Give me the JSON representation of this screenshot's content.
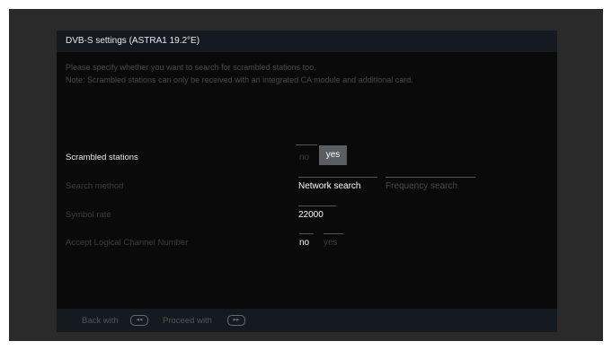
{
  "header": {
    "title": "DVB-S settings (ASTRA1 19.2°E)"
  },
  "description": {
    "line1": "Please specify whether you want to search for scrambled stations too.",
    "line2": "Note: Scrambled stations can only be received with an integrated CA module and additional card."
  },
  "settings": {
    "scrambled": {
      "label": "Scrambled stations",
      "options": [
        "no",
        "yes"
      ],
      "selected": "yes"
    },
    "search_method": {
      "label": "Search method",
      "options": [
        "Network search",
        "Frequency search"
      ],
      "selected": "Network search"
    },
    "symbol_rate": {
      "label": "Symbol rate",
      "value": "22000"
    },
    "lcn": {
      "label": "Accept Logical Channel Number",
      "options": [
        "no",
        "yes"
      ],
      "selected": "no"
    }
  },
  "footer": {
    "back_label": "Back with",
    "back_icon": "◂◂",
    "proceed_label": "Proceed with",
    "proceed_icon": "▸▸"
  },
  "colors": {
    "background": "#0a0a0a",
    "bar": "#151a21",
    "selected": "#5a5d61"
  }
}
